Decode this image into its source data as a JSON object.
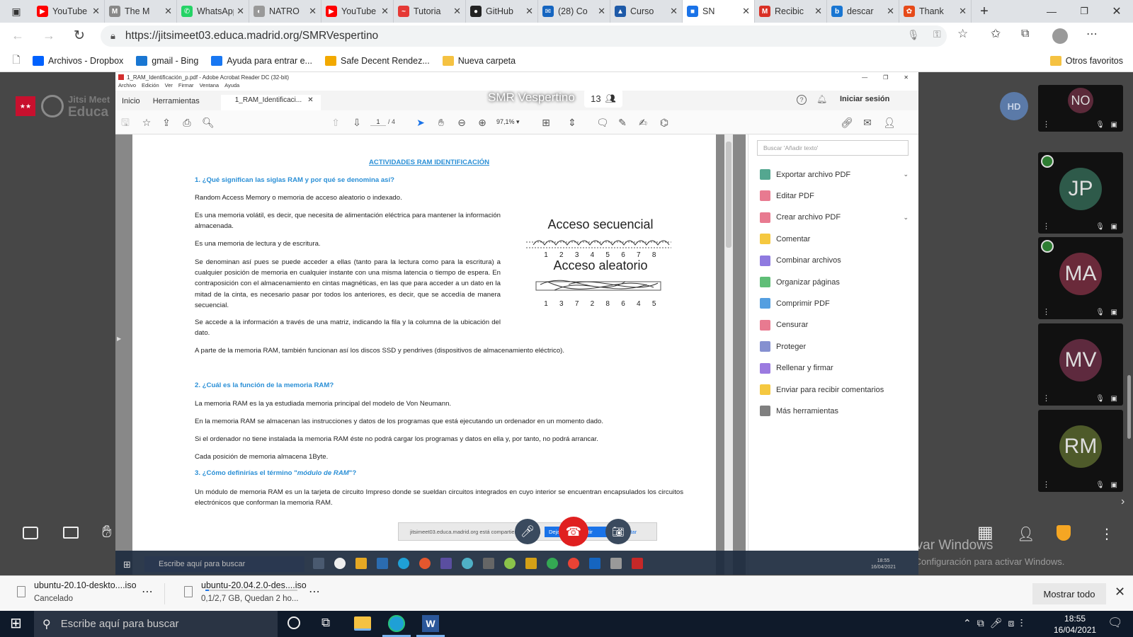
{
  "browser": {
    "tabs": [
      {
        "title": "YouTube",
        "color": "#ff0000",
        "glyph": "▶"
      },
      {
        "title": "The M",
        "color": "#888888",
        "glyph": "M"
      },
      {
        "title": "WhatsApp",
        "color": "#25d366",
        "glyph": "✆"
      },
      {
        "title": "NATRO",
        "color": "#999999",
        "glyph": "◐"
      },
      {
        "title": "YouTube",
        "color": "#ff0000",
        "glyph": "▶"
      },
      {
        "title": "Tutoria",
        "color": "#e53935",
        "glyph": "~"
      },
      {
        "title": "GitHub",
        "color": "#222222",
        "glyph": "●"
      },
      {
        "title": "(28) Co",
        "color": "#1565c0",
        "glyph": "✉"
      },
      {
        "title": "Curso",
        "color": "#1e5aa8",
        "glyph": "▲"
      },
      {
        "title": "SN",
        "color": "#1a73e8",
        "glyph": "■",
        "active": true
      },
      {
        "title": "Recibic",
        "color": "#d93025",
        "glyph": "M"
      },
      {
        "title": "descar",
        "color": "#1976d2",
        "glyph": "b"
      },
      {
        "title": "Thank",
        "color": "#e64a19",
        "glyph": "✿"
      }
    ],
    "url": "https://jitsimeet03.educa.madrid.org/SMRVespertino",
    "bookmarks": [
      {
        "label": "Archivos - Dropbox",
        "color": "#0061fe"
      },
      {
        "label": "gmail - Bing",
        "color": "#1976d2"
      },
      {
        "label": "Ayuda para entrar e...",
        "color": "#1877f2"
      },
      {
        "label": "Safe Decent Rendez...",
        "color": "#f2a900"
      },
      {
        "label": "Nueva carpeta",
        "color": "#f5c242"
      }
    ],
    "other_favorites": "Otros favoritos"
  },
  "jitsi": {
    "room_name": "SMR Vespertino",
    "participant_count": "13",
    "logo_text_1": "Jitsi Meet",
    "logo_text_2": "Educa",
    "local_avatar": "HD",
    "share_notice": "jitsimeet03.educa.madrid.org está compartiendo su pantalla.",
    "share_stop": "Dejar de compartir",
    "share_hide": "Ocultar",
    "participants": [
      {
        "initials": "NO",
        "color": "#5c2a3a"
      },
      {
        "initials": "JP",
        "color": "#2e5a4a"
      },
      {
        "initials": "MA",
        "color": "#6a2a3a"
      },
      {
        "initials": "MV",
        "color": "#5e2a3e"
      },
      {
        "initials": "RM",
        "color": "#4e5a2a"
      }
    ],
    "activate_title": "Activar Windows",
    "activate_sub": "Ve a Configuración para activar Windows."
  },
  "acrobat": {
    "title": "1_RAM_Identificación_p.pdf - Adobe Acrobat Reader DC (32-bit)",
    "menu": [
      "Archivo",
      "Edición",
      "Ver",
      "Firmar",
      "Ventana",
      "Ayuda"
    ],
    "tabs": [
      "Inicio",
      "Herramientas",
      "1_RAM_Identificaci..."
    ],
    "signin": "Iniciar sesión",
    "page_current": "1",
    "page_total": "/ 4",
    "zoom": "97,1%",
    "search_placeholder": "Buscar 'Añadir texto'",
    "tools": [
      {
        "label": "Exportar archivo PDF",
        "color": "#1b8a6b",
        "chevron": true
      },
      {
        "label": "Editar PDF",
        "color": "#e04e6b"
      },
      {
        "label": "Crear archivo PDF",
        "color": "#e04e6b",
        "chevron": true
      },
      {
        "label": "Comentar",
        "color": "#f2b600"
      },
      {
        "label": "Combinar archivos",
        "color": "#6a4ed6"
      },
      {
        "label": "Organizar páginas",
        "color": "#2aa84a"
      },
      {
        "label": "Comprimir PDF",
        "color": "#1c7fd6"
      },
      {
        "label": "Censurar",
        "color": "#e04e6b"
      },
      {
        "label": "Proteger",
        "color": "#5c6bc0"
      },
      {
        "label": "Rellenar y firmar",
        "color": "#7a4ed6"
      },
      {
        "label": "Enviar para recibir comentarios",
        "color": "#f2b600"
      },
      {
        "label": "Más herramientas",
        "color": "#555555"
      }
    ]
  },
  "document": {
    "title": "ACTIVIDADES RAM IDENTIFICACIÓN",
    "q1": "1.    ¿Qué significan las siglas RAM y por qué se denomina así?",
    "p1": "Random Access Memory o memoria de acceso aleatorio o indexado.",
    "p2": "Es una memoria volátil, es decir, que necesita de alimentación eléctrica para mantener la información almacenada.",
    "p3": "Es una memoria de lectura y de escritura.",
    "p4": "Se denominan así pues se puede acceder a ellas (tanto para la lectura como para la escritura) a cualquier posición de memoria en cualquier instante con una misma latencia o tiempo de espera. En contraposición con el almacenamiento en cintas magnéticas, en las que para acceder a un dato en la mitad de la cinta, es necesario pasar por todos los anteriores, es decir, que se accedía de manera secuencial.",
    "p5": "Se accede a la información a través de una matriz, indicando la fila y la columna de la ubicación del dato.",
    "p6": "A parte de la memoria RAM, también funcionan así los discos SSD y pendrives (dispositivos de almacenamiento eléctrico).",
    "q2": "2.    ¿Cuál es la función de la memoria RAM?",
    "p7": "La memoria RAM es la ya estudiada memoria principal del modelo de Von Neumann.",
    "p8": "En la memoria RAM se almacenan las instrucciones y datos de los programas que está ejecutando un ordenador en un momento dado.",
    "p9": "Si el ordenador no tiene instalada la memoria RAM éste no podrá cargar los programas y datos en ella y, por tanto, no podrá arrancar.",
    "p10": "Cada posición de memoria almacena 1Byte.",
    "q3_prefix": "3.    ¿Cómo definirías el término \"",
    "q3_em": "módulo de RAM",
    "q3_suffix": "\"?",
    "p11": "Un módulo de memoria RAM es un la tarjeta de circuito Impreso donde se sueldan circuitos integrados en cuyo interior se encuentran encapsulados los circuitos electrónicos que conforman la memoria RAM.",
    "fig_seq_title": "Acceso secuencial",
    "fig_seq_nums": [
      "1",
      "2",
      "3",
      "4",
      "5",
      "6",
      "7",
      "8"
    ],
    "fig_rand_title": "Acceso aleatorio",
    "fig_rand_nums": [
      "1",
      "3",
      "7",
      "2",
      "8",
      "6",
      "4",
      "5"
    ]
  },
  "inner_taskbar": {
    "search": "Escribe aquí para buscar",
    "time": "18:55",
    "date": "16/04/2021"
  },
  "downloads": [
    {
      "name": "ubuntu-20.10-deskto....iso",
      "status": "Cancelado"
    },
    {
      "name": "ubuntu-20.04.2.0-des....iso",
      "status": "0,1/2,7 GB, Quedan 2 ho...",
      "progress": 0.04
    }
  ],
  "show_all": "Mostrar todo",
  "taskbar": {
    "search": "Escribe aquí para buscar",
    "time": "18:55",
    "date": "16/04/2021"
  }
}
